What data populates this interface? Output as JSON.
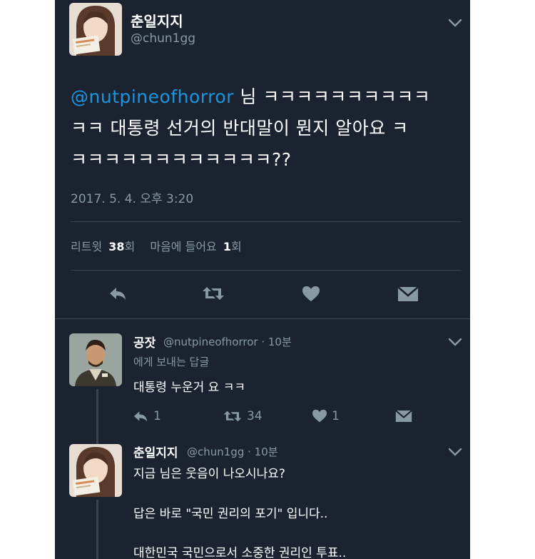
{
  "main_tweet": {
    "display_name": "춘일지지",
    "handle": "@chun1gg",
    "mention": "@nutpineofhorror",
    "line1_rest": " 님 ㅋㅋㅋㅋㅋㅋㅋㅋㅋㅋ",
    "line2": "ㅋㅋ 대통령 선거의 반대말이 뭔지 알아요 ㅋ",
    "line3": "ㅋㅋㅋㅋㅋㅋㅋㅋㅋㅋㅋㅋ??",
    "timestamp": "2017. 5. 4. 오후 3:20",
    "stats": {
      "retweet_label": "리트윗",
      "retweet_count": "38",
      "retweet_unit": "회",
      "like_label": "마음에 들어요",
      "like_count": "1",
      "like_unit": "회"
    }
  },
  "reply1": {
    "display_name": "공잣",
    "handle": "@nutpineofhorror",
    "time": "· 10분",
    "reply_to": "에게 보내는 답글",
    "text": "대통령 누운거 요 ㅋㅋ",
    "reply_count": "1",
    "retweet_count": "34",
    "like_count": "1"
  },
  "reply2": {
    "display_name": "춘일지지",
    "handle": "@chun1gg",
    "time": "· 10분",
    "line1": "지금 님은 웃음이 나오시나요?",
    "line2": "답은 바로 \"국민 권리의 포기\" 입니다..",
    "line3": "대한민국 국민으로서 소중한 권리인 투표.."
  },
  "icons": {
    "main_actions": [
      "reply-icon",
      "retweet-icon",
      "heart-icon",
      "message-icon"
    ],
    "caret": "chevron-down-icon"
  },
  "colors": {
    "background": "#1b2330",
    "mention": "#1b95e0",
    "muted": "#8899a6",
    "divider": "#38444d"
  }
}
